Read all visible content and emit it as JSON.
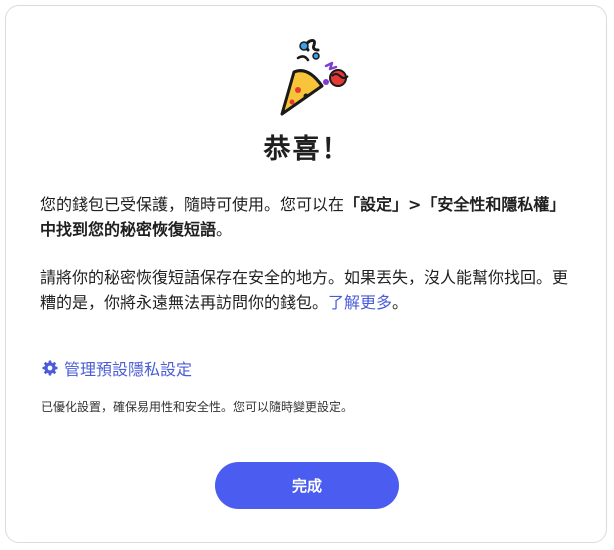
{
  "dialog": {
    "title": "恭喜！",
    "paragraph1": {
      "text_part1": "您的錢包已受保護，隨時可使用。您可以在",
      "bold_part": "「設定」>「安全性和隱私權」中找到您的秘密恢復短語",
      "text_part2": "。"
    },
    "paragraph2": {
      "text": "請將你的秘密恢復短語保存在安全的地方。如果丟失，沒人能幫你找回。更糟的是，你將永遠無法再訪問你的錢包。",
      "link_label": "了解更多",
      "link_suffix": "。"
    },
    "privacy_link_label": "管理預設隱私設定",
    "note": "已優化設置，確保易用性和安全性。您可以隨時變更設定。",
    "done_button_label": "完成"
  },
  "icons": {
    "celebration": "party-popper-icon",
    "settings": "gear-icon"
  },
  "colors": {
    "accent": "#4b5cf0",
    "link": "#4a5cd6",
    "popper_body": "#f8c43a"
  }
}
